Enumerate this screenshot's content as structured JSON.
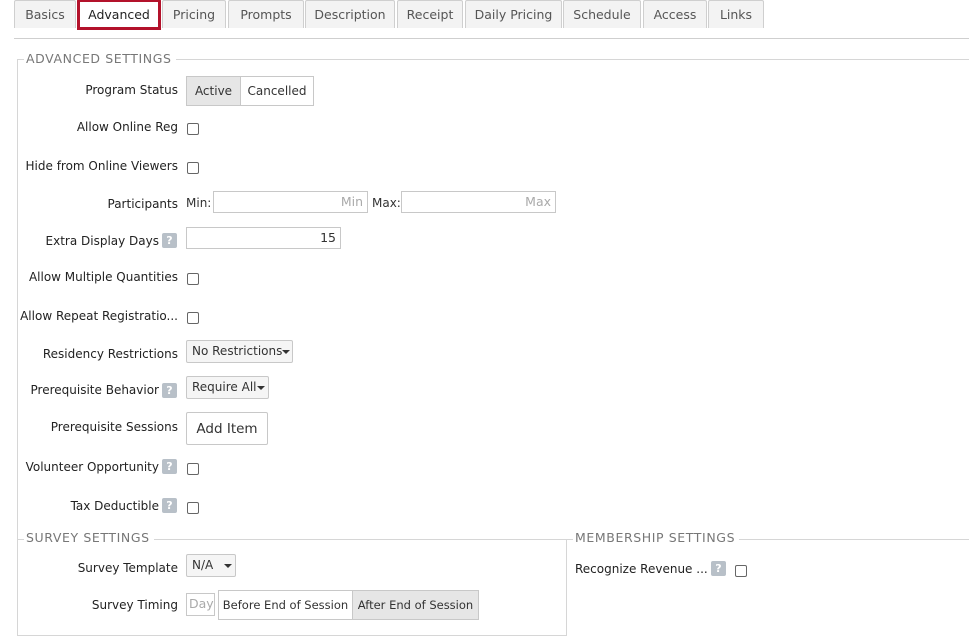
{
  "tabs": [
    "Basics",
    "Advanced",
    "Pricing",
    "Prompts",
    "Description",
    "Receipt",
    "Daily Pricing",
    "Schedule",
    "Access",
    "Links"
  ],
  "active_tab": "Advanced",
  "advanced": {
    "legend": "ADVANCED SETTINGS",
    "program_status": {
      "label": "Program Status",
      "options": [
        "Active",
        "Cancelled"
      ],
      "selected": "Active"
    },
    "allow_online_reg": "Allow Online Reg",
    "hide_from_online_viewers": "Hide from Online Viewers",
    "participants": {
      "label": "Participants",
      "min_label": "Min:",
      "min_placeholder": "Min",
      "max_label": "Max:",
      "max_placeholder": "Max"
    },
    "extra_display_days": {
      "label": "Extra Display Days",
      "value": "15"
    },
    "allow_multiple_quantities": "Allow Multiple Quantities",
    "allow_repeat_registration": "Allow Repeat Registratio...",
    "residency_restrictions": {
      "label": "Residency Restrictions",
      "value": "No Restrictions"
    },
    "prerequisite_behavior": {
      "label": "Prerequisite Behavior",
      "value": "Require All"
    },
    "prerequisite_sessions": {
      "label": "Prerequisite Sessions",
      "button": "Add Item"
    },
    "volunteer_opportunity": "Volunteer Opportunity",
    "tax_deductible": "Tax Deductible"
  },
  "survey": {
    "legend": "SURVEY SETTINGS",
    "template": {
      "label": "Survey Template",
      "value": "N/A"
    },
    "timing": {
      "label": "Survey Timing",
      "day_placeholder": "Day",
      "options": [
        "Before End of Session",
        "After End of Session"
      ],
      "selected": "After End of Session"
    }
  },
  "membership": {
    "legend": "MEMBERSHIP SETTINGS",
    "recognize_revenue": "Recognize Revenue ..."
  },
  "help_glyph": "?"
}
